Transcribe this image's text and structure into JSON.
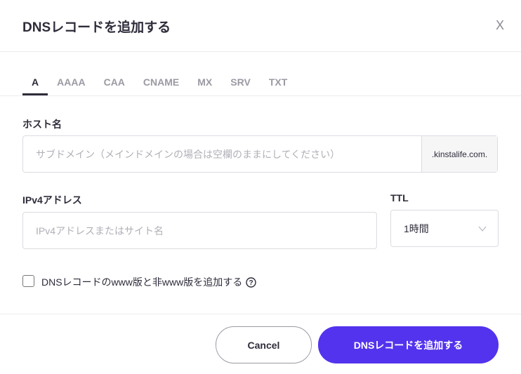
{
  "dialog": {
    "title": "DNSレコードを追加する",
    "close": "X"
  },
  "tabs": [
    {
      "label": "A",
      "active": true
    },
    {
      "label": "AAAA"
    },
    {
      "label": "CAA"
    },
    {
      "label": "CNAME"
    },
    {
      "label": "MX"
    },
    {
      "label": "SRV"
    },
    {
      "label": "TXT"
    }
  ],
  "host": {
    "label": "ホスト名",
    "placeholder": "サブドメイン（メインドメインの場合は空欄のままにしてください）",
    "suffix": ".kinstalife.com."
  },
  "ipv4": {
    "label": "IPv4アドレス",
    "placeholder": "IPv4アドレスまたはサイト名"
  },
  "ttl": {
    "label": "TTL",
    "value": "1時間"
  },
  "www_checkbox": {
    "label": "DNSレコードのwww版と非www版を追加する",
    "checked": false
  },
  "footer": {
    "cancel": "Cancel",
    "submit": "DNSレコードを追加する"
  },
  "colors": {
    "accent": "#5333ed"
  }
}
